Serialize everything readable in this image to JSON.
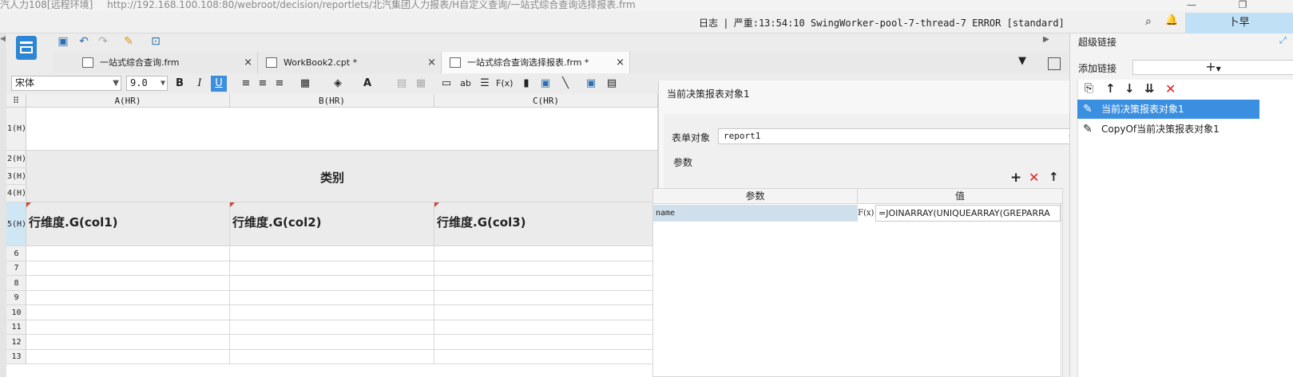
{
  "titlebar": {
    "window_title": "汽人力108[远程环境]",
    "url": "http://192.168.100.108:80/webroot/decision/reportlets/北汽集团人力报表/H自定义查询/一站式综合查询选择报表.frm"
  },
  "logbar": {
    "log_label": "日志",
    "log_message": "严重:13:54:10 SwingWorker-pool-7-thread-7 ERROR [standard]",
    "user": "卜早"
  },
  "tabs": [
    {
      "label": "一站式综合查询.frm",
      "close": "×"
    },
    {
      "label": "WorkBook2.cpt *",
      "close": "×"
    },
    {
      "label": "一站式综合查询选择报表.frm *",
      "close": "×"
    }
  ],
  "format": {
    "font_name": "宋体",
    "font_size": "9.0",
    "bold": "B",
    "italic": "I",
    "underline": "U",
    "text_style": "ab",
    "formula": "F(x)"
  },
  "sheet": {
    "columns": [
      "A(HR)",
      "B(HR)",
      "C(HR)"
    ],
    "rows": [
      "1(H)",
      "2(H)",
      "3(H)",
      "4(H)",
      "5(H)",
      "6",
      "7",
      "8",
      "9",
      "10",
      "11",
      "12",
      "13"
    ],
    "merged_title": "类别",
    "header_cells": [
      "行维度.G(col1)",
      "行维度.G(col2)",
      "行维度.G(col3)"
    ]
  },
  "props": {
    "title": "当前决策报表对象1",
    "form_object_label": "表单对象",
    "form_object_value": "report1",
    "params_label": "参数",
    "table_headers": [
      "参数",
      "值"
    ],
    "param_rows": [
      {
        "name": "name",
        "fx": "F(x)",
        "value": "=JOINARRAY(UNIQUEARRAY(GREPARRA"
      }
    ]
  },
  "hyperlink": {
    "title": "超级链接",
    "add_label": "添加链接",
    "items": [
      "当前决策报表对象1",
      "CopyOf当前决策报表对象1"
    ]
  },
  "colors": {
    "selection": "#3a8fe0",
    "row_highlight": "#cfe0ec",
    "user_area": "#bfe0f5",
    "delete_red": "#e02020"
  }
}
